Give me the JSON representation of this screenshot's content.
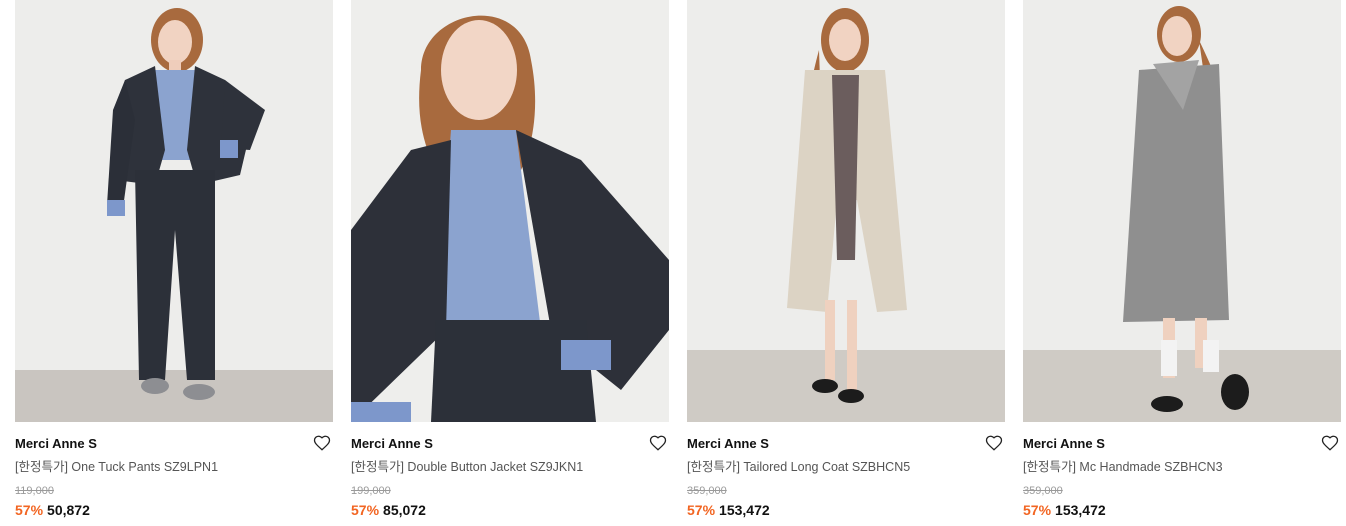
{
  "products": [
    {
      "brand": "Merci Anne S",
      "name": "[한정특가] One Tuck Pants SZ9LPN1",
      "original_price": "119,000",
      "discount": "57%",
      "sale_price": "50,872",
      "image": "model-in-navy-pinstripe-suit"
    },
    {
      "brand": "Merci Anne S",
      "name": "[한정특가] Double Button Jacket SZ9JKN1",
      "original_price": "199,000",
      "discount": "57%",
      "sale_price": "85,072",
      "image": "model-in-pinstripe-double-button-jacket"
    },
    {
      "brand": "Merci Anne S",
      "name": "[한정특가] Tailored Long Coat SZBHCN5",
      "original_price": "359,000",
      "discount": "57%",
      "sale_price": "153,472",
      "image": "model-in-beige-long-coat"
    },
    {
      "brand": "Merci Anne S",
      "name": "[한정특가] Mc Handmade SZBHCN3",
      "original_price": "359,000",
      "discount": "57%",
      "sale_price": "153,472",
      "image": "model-in-grey-handmade-coat"
    }
  ],
  "colors": {
    "discount": "#f26522",
    "price": "#111111",
    "strike": "#9a9a9a"
  }
}
